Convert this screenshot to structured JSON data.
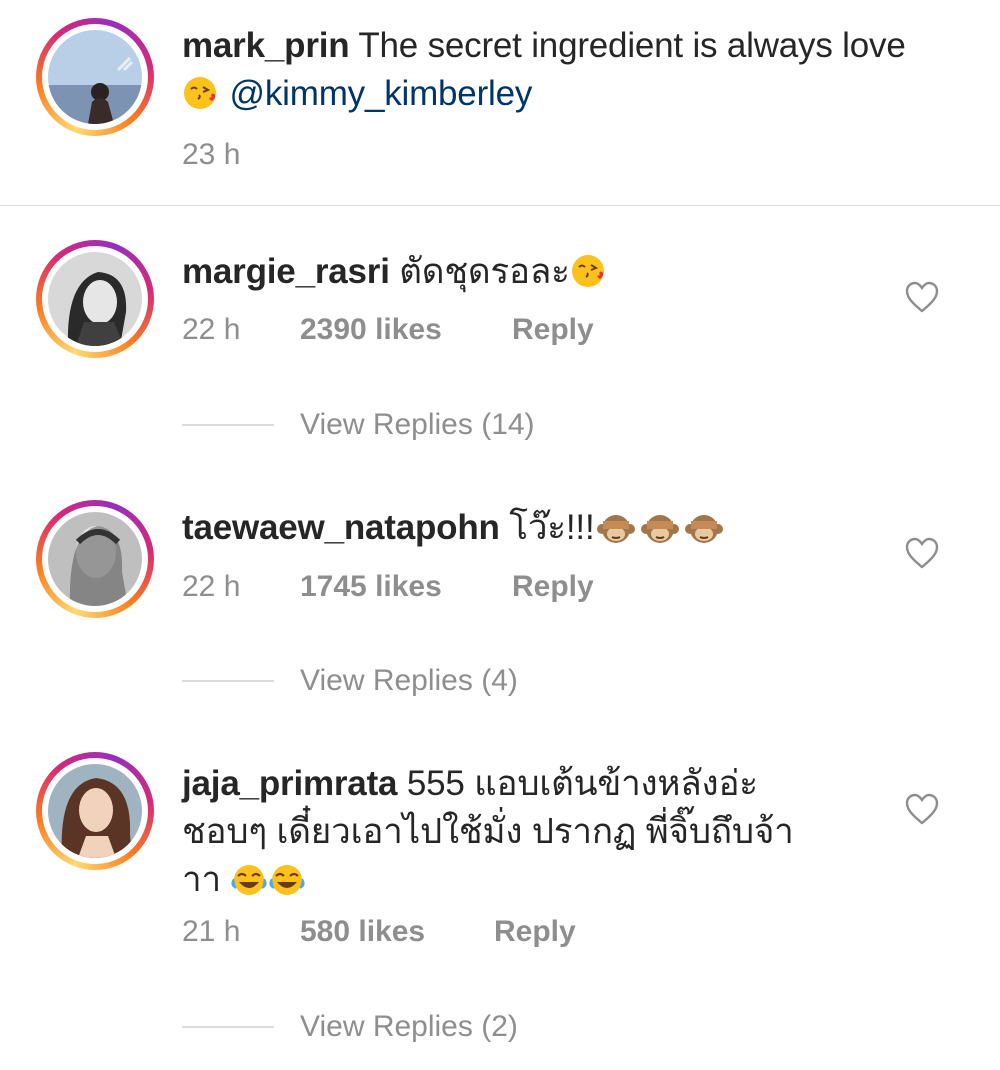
{
  "caption": {
    "username": "mark_prin",
    "text": "The secret ingredient is always love",
    "mention": "@kimmy_kimberley",
    "time": "23 h"
  },
  "comments": [
    {
      "username": "margie_rasri",
      "text": "ตัดชุดรอละ",
      "time": "22 h",
      "likes": "2390 likes",
      "reply": "Reply",
      "view_replies": "View Replies (14)"
    },
    {
      "username": "taewaew_natapohn",
      "text": "โว๊ะ!!!",
      "time": "22 h",
      "likes": "1745 likes",
      "reply": "Reply",
      "view_replies": "View Replies (4)"
    },
    {
      "username": "jaja_primrata",
      "text_line1": "555 แอบเต้นข้างหลังอ่ะ",
      "text_line2": "ชอบๆ เดี๋ยวเอาไปใช้มั่ง ปรากฏ พี่จิ๊บถึบจ้า",
      "text_line3": "าา",
      "time": "21 h",
      "likes": "580 likes",
      "reply": "Reply",
      "view_replies": "View Replies (2)"
    }
  ],
  "icons": {
    "heart": "heart-outline-icon",
    "kiss_emoji": "face-blowing-kiss-icon",
    "monkey_emoji": "see-no-evil-monkey-icon",
    "laugh_emoji": "face-with-tears-of-joy-icon"
  },
  "colors": {
    "text": "#262626",
    "secondary": "#8e8e8e",
    "mention": "#003569",
    "divider": "#dbdbdb"
  }
}
